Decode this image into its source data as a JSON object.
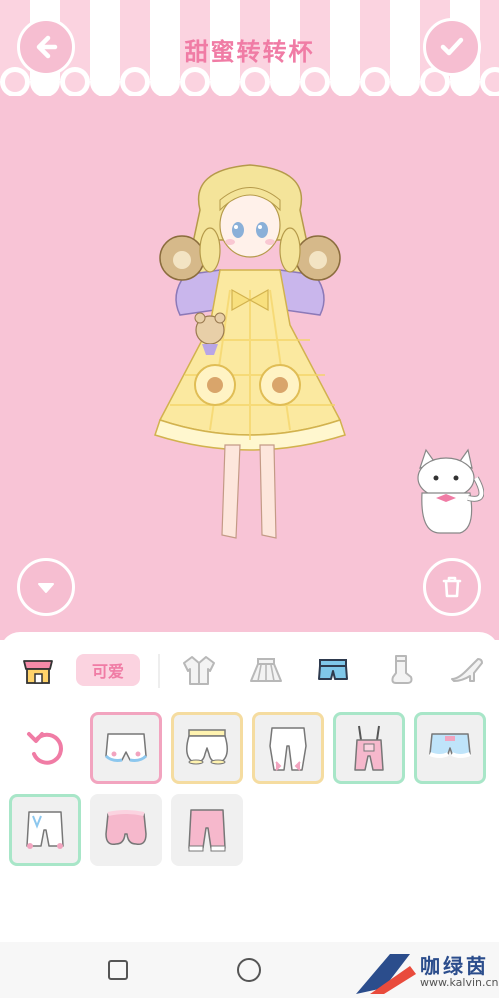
{
  "header": {
    "title": "甜蜜转转杯",
    "back_icon": "arrow-left-icon",
    "confirm_icon": "checkmark-icon"
  },
  "stage": {
    "collapse_icon": "triangle-down-icon",
    "trash_icon": "trash-icon",
    "doll": "lolita-doll-yellow-dress",
    "pet": "white-cat-pet"
  },
  "categories": {
    "shop_icon": "shop-icon",
    "style_tag": "可爱",
    "tabs": [
      {
        "icon": "jacket-icon",
        "selected": false
      },
      {
        "icon": "skirt-icon",
        "selected": false
      },
      {
        "icon": "pants-icon",
        "selected": true
      },
      {
        "icon": "socks-icon",
        "selected": false
      },
      {
        "icon": "shoes-icon",
        "selected": false
      }
    ]
  },
  "items": [
    {
      "name": "white-bloomers-blue-trim",
      "rarity": "pink",
      "selected": true
    },
    {
      "name": "white-pumpkin-shorts-yellow",
      "rarity": "yellow"
    },
    {
      "name": "white-bloomers-pink-bows",
      "rarity": "yellow"
    },
    {
      "name": "pink-overalls",
      "rarity": "green"
    },
    {
      "name": "light-blue-frill-shorts",
      "rarity": "green"
    },
    {
      "name": "white-shorts-blue-bows",
      "rarity": "green"
    },
    {
      "name": "pink-pumpkin-shorts",
      "rarity": "none"
    },
    {
      "name": "pink-bloomers-lace",
      "rarity": "none"
    }
  ],
  "colors": {
    "stage_bg": "#f8c4d6",
    "accent": "#f07ca5",
    "button_bg": "#f6bed1"
  },
  "watermark": {
    "text": "咖绿茵",
    "url": "www.kalvin.cn"
  }
}
